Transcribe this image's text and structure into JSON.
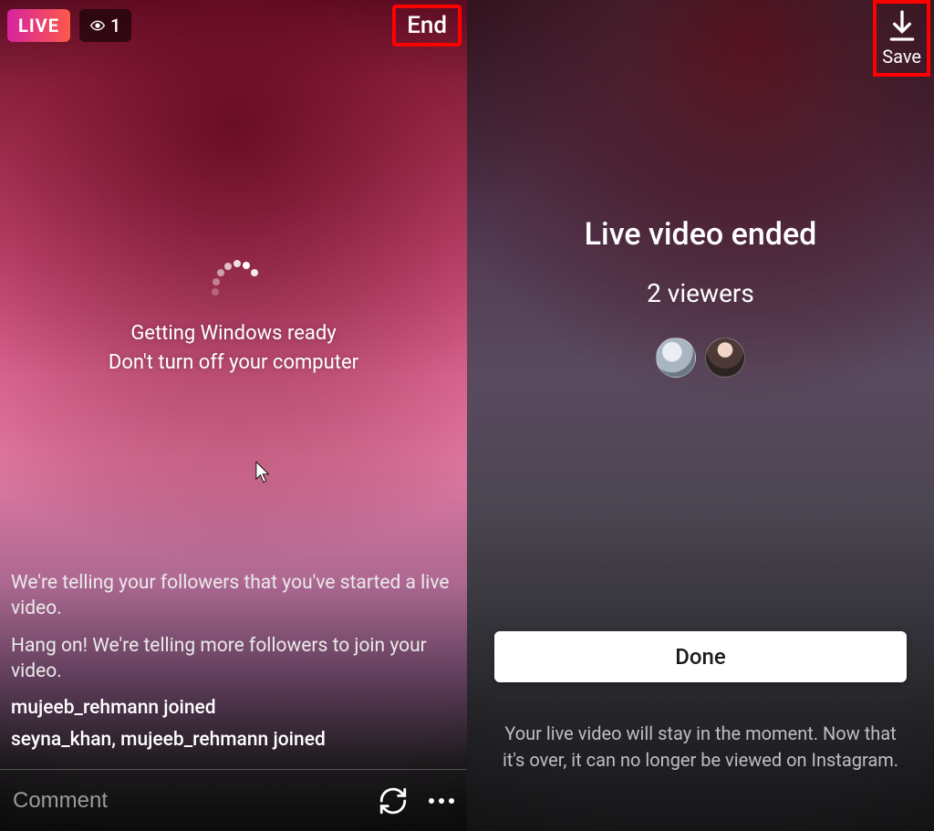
{
  "left": {
    "live_badge": "LIVE",
    "viewer_count": "1",
    "end_label": "End",
    "spinner_line1": "Getting Windows ready",
    "spinner_line2": "Don't turn off your computer",
    "status_msg1": "We're telling your followers that you've started a live video.",
    "status_msg2": "Hang on! We're telling more followers to join your video.",
    "joined1": "mujeeb_rehmann joined",
    "joined2": "seyna_khan, mujeeb_rehmann joined",
    "comment_placeholder": "Comment"
  },
  "right": {
    "save_label": "Save",
    "title": "Live video ended",
    "subtitle": "2 viewers",
    "done_label": "Done",
    "footnote": "Your live video will stay in the moment. Now that it's over, it can no longer be viewed on Instagram."
  }
}
